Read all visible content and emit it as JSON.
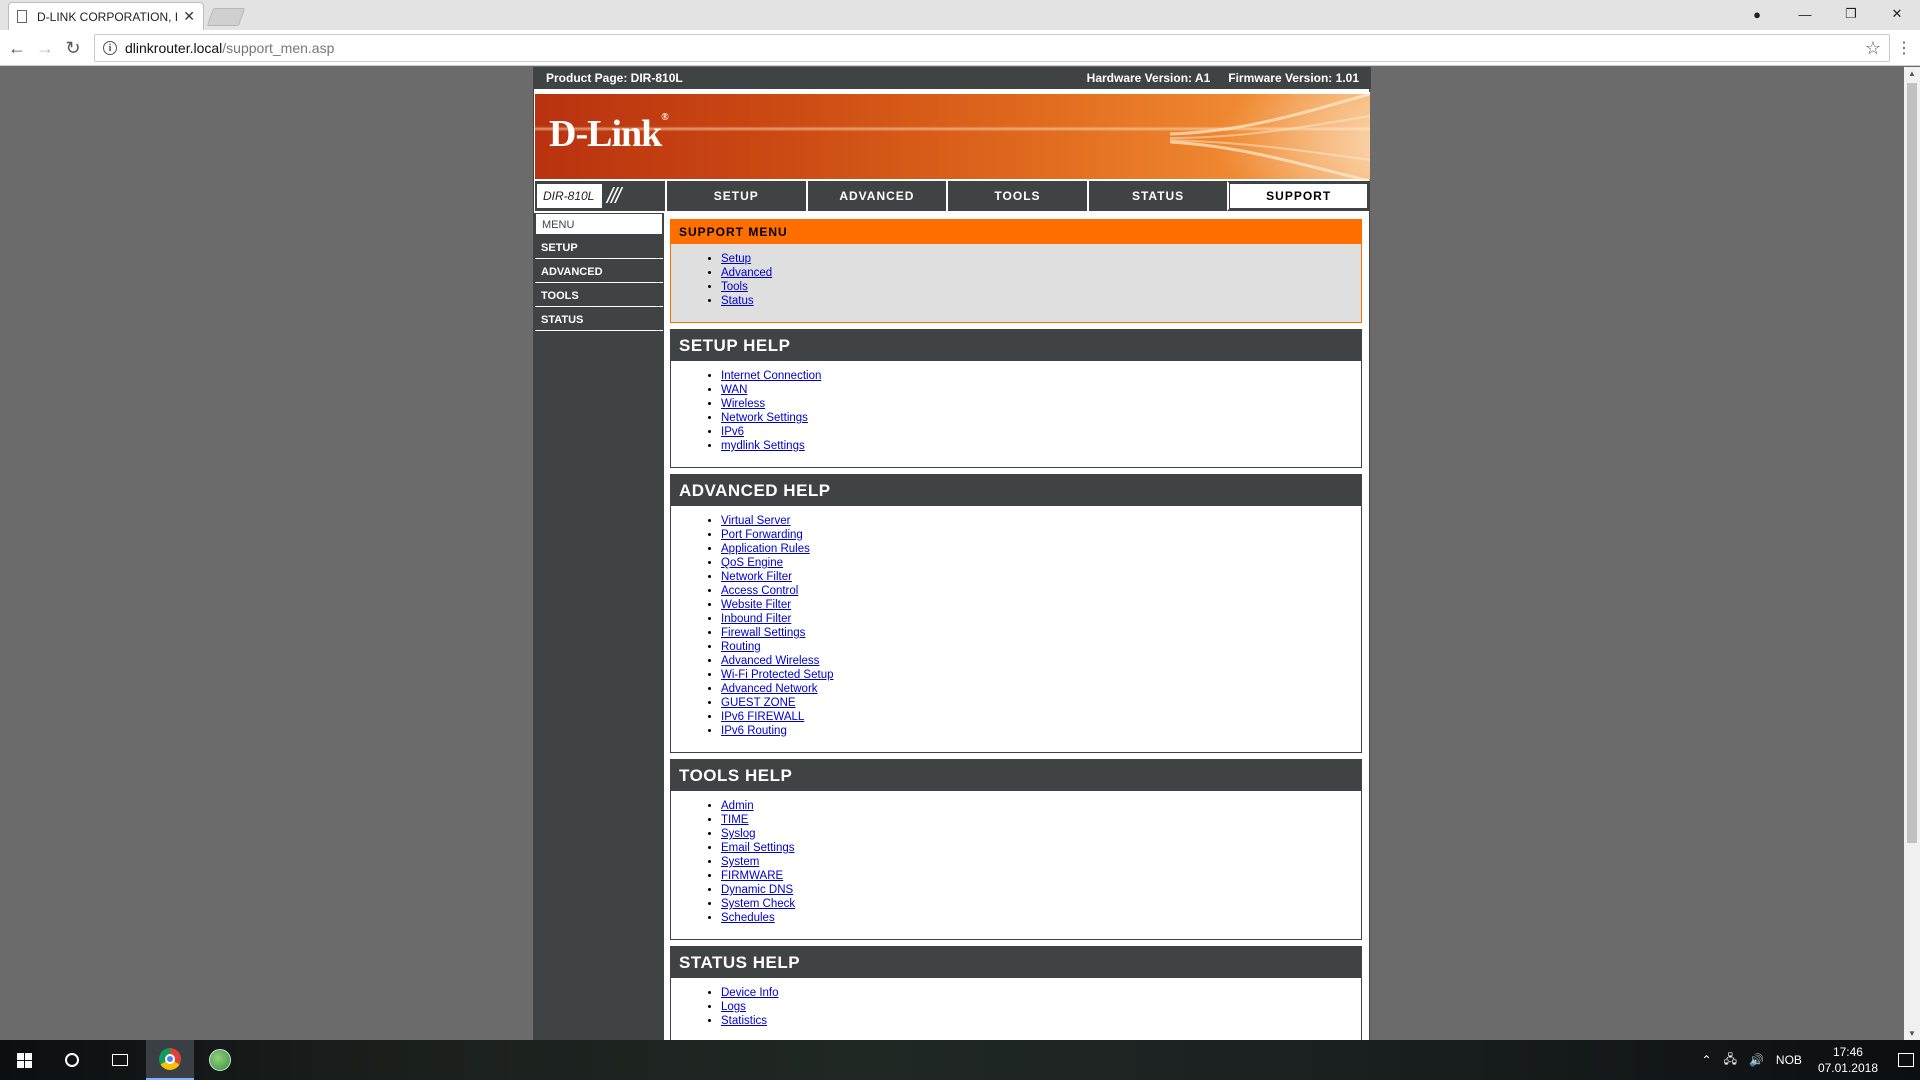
{
  "browser": {
    "tab_title": "D-LINK CORPORATION, I",
    "url_host": "dlinkrouter.local",
    "url_path": "/support_men.asp"
  },
  "router": {
    "product_page": "Product Page: DIR-810L",
    "hardware_version": "Hardware Version: A1",
    "firmware_version": "Firmware Version: 1.01",
    "logo": "D-Link",
    "logo_mark": "®",
    "model": "DIR-810L",
    "model_slashes": "///",
    "nav": [
      {
        "label": "SETUP",
        "active": false
      },
      {
        "label": "ADVANCED",
        "active": false
      },
      {
        "label": "TOOLS",
        "active": false
      },
      {
        "label": "STATUS",
        "active": false
      },
      {
        "label": "SUPPORT",
        "active": true
      }
    ],
    "sidebar": {
      "menu_label": "MENU",
      "items": [
        "SETUP",
        "ADVANCED",
        "TOOLS",
        "STATUS"
      ]
    },
    "sections": [
      {
        "title": "SUPPORT MENU",
        "style": "orange",
        "links": [
          "Setup",
          "Advanced",
          "Tools",
          "Status"
        ]
      },
      {
        "title": "SETUP HELP",
        "style": "dark",
        "links": [
          "Internet Connection",
          "WAN",
          "Wireless",
          "Network Settings",
          "IPv6",
          "mydlink Settings"
        ]
      },
      {
        "title": "ADVANCED HELP",
        "style": "dark",
        "links": [
          "Virtual Server",
          "Port Forwarding",
          "Application Rules",
          "QoS Engine",
          "Network Filter",
          "Access Control",
          "Website Filter",
          "Inbound Filter",
          "Firewall Settings",
          "Routing",
          "Advanced Wireless",
          "Wi-Fi Protected Setup",
          "Advanced Network",
          "GUEST ZONE",
          "IPv6 FIREWALL",
          "IPv6 Routing"
        ]
      },
      {
        "title": "TOOLS HELP",
        "style": "dark",
        "links": [
          "Admin",
          "TIME",
          "Syslog",
          "Email Settings",
          "System",
          "FIRMWARE",
          "Dynamic DNS",
          "System Check",
          "Schedules"
        ]
      },
      {
        "title": "STATUS HELP",
        "style": "dark",
        "links": [
          "Device Info",
          "Logs",
          "Statistics"
        ]
      }
    ]
  },
  "taskbar": {
    "language": "NOB",
    "time": "17:46",
    "date": "07.01.2018"
  },
  "colors": {
    "accent_orange": "#ff6f00",
    "dark_gray": "#404343",
    "link_blue": "#0000cc"
  }
}
